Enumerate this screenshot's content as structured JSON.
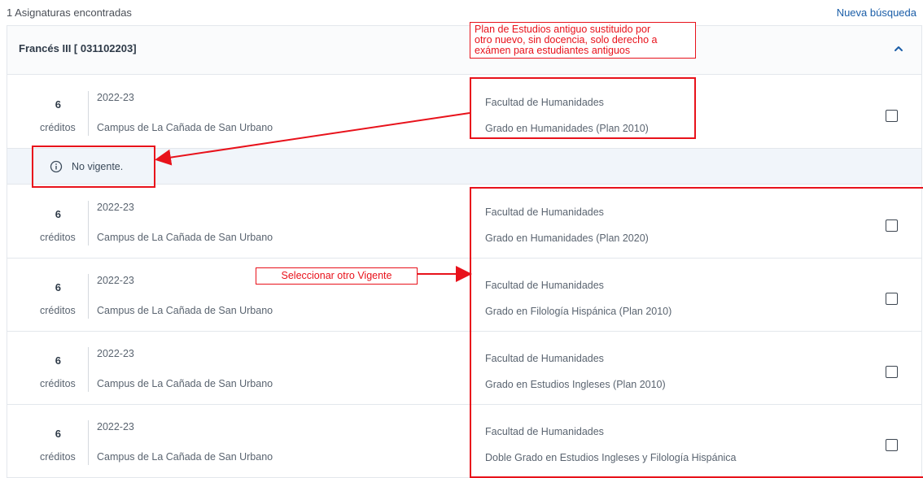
{
  "header": {
    "results_count": "1 Asignaturas encontradas",
    "new_search_label": "Nueva búsqueda"
  },
  "subject": {
    "title": "Francés III [ 031102203]",
    "expand_icon": "chevron-up-icon"
  },
  "offerings": [
    {
      "credits": "6",
      "credits_label": "créditos",
      "year": "2022-23",
      "campus": "Campus de La Cañada de San Urbano",
      "faculty": "Facultad de Humanidades",
      "degree": "Grado en Humanidades (Plan 2010)",
      "selected": false
    },
    {
      "credits": "6",
      "credits_label": "créditos",
      "year": "2022-23",
      "campus": "Campus de La Cañada de San Urbano",
      "faculty": "Facultad de Humanidades",
      "degree": "Grado en Humanidades (Plan 2020)",
      "selected": false
    },
    {
      "credits": "6",
      "credits_label": "créditos",
      "year": "2022-23",
      "campus": "Campus de La Cañada de San Urbano",
      "faculty": "Facultad de Humanidades",
      "degree": "Grado en Filología Hispánica (Plan 2010)",
      "selected": false
    },
    {
      "credits": "6",
      "credits_label": "créditos",
      "year": "2022-23",
      "campus": "Campus de La Cañada de San Urbano",
      "faculty": "Facultad de Humanidades",
      "degree": "Grado en Estudios Ingleses (Plan 2010)",
      "selected": false
    },
    {
      "credits": "6",
      "credits_label": "créditos",
      "year": "2022-23",
      "campus": "Campus de La Cañada de San Urbano",
      "faculty": "Facultad de Humanidades",
      "degree": "Doble Grado en Estudios Ingleses y Filología Hispánica",
      "selected": false
    }
  ],
  "notice": {
    "icon": "info-icon",
    "text": "No vigente."
  },
  "annotations": {
    "old_plan_note_line1": "Plan de Estudios antiguo sustituido por",
    "old_plan_note_line2": "otro nuevo, sin docencia, solo derecho a",
    "old_plan_note_line3": "exámen para estudiantes antiguos",
    "select_other_note": "Seleccionar otro Vigente",
    "color": "#e8121b"
  }
}
